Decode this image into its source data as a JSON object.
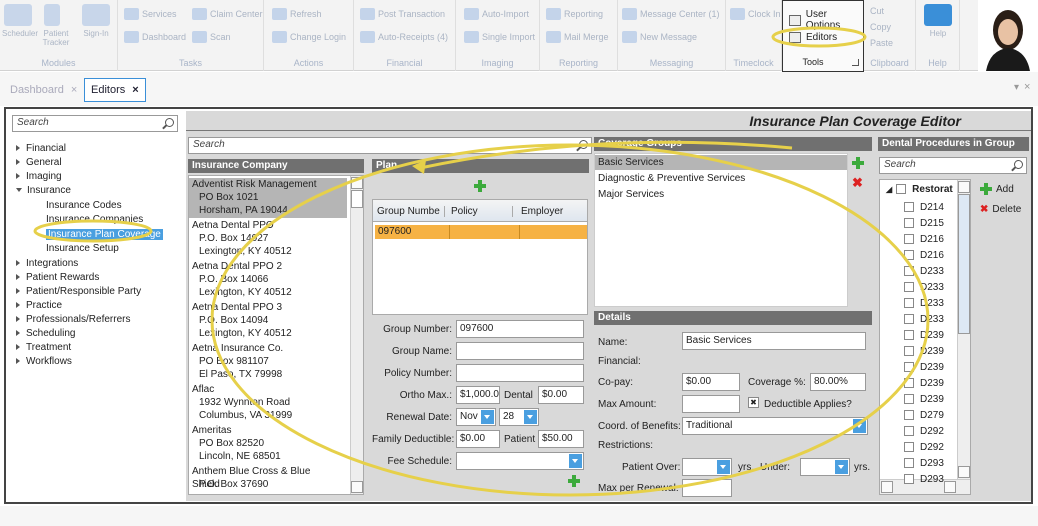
{
  "ribbon": {
    "modules": {
      "label": "Modules",
      "items": [
        "Scheduler",
        "Patient Tracker",
        "Sign-In"
      ]
    },
    "tasks": {
      "label": "Tasks",
      "items": [
        "Services",
        "Claim Center",
        "Dashboard",
        "Scan"
      ]
    },
    "actions": {
      "label": "Actions",
      "items": [
        "Refresh",
        "Change Login"
      ]
    },
    "financial": {
      "label": "Financial",
      "items": [
        "Post Transaction",
        "Auto-Receipts (4)"
      ]
    },
    "imaging": {
      "label": "Imaging",
      "items": [
        "Auto-Import",
        "Single Import"
      ]
    },
    "reporting": {
      "label": "Reporting",
      "items": [
        "Reporting",
        "Mail Merge"
      ]
    },
    "messaging": {
      "label": "Messaging",
      "items": [
        "Message Center (1)",
        "New Message"
      ]
    },
    "timeclock": {
      "label": "Timeclock",
      "items": [
        "Clock In"
      ]
    },
    "tools": {
      "label": "Tools",
      "items": [
        "User Options",
        "Editors"
      ]
    },
    "clipboard": {
      "label": "Clipboard",
      "items": [
        "Cut",
        "Copy",
        "Paste"
      ]
    },
    "help": {
      "label": "Help",
      "items": [
        "Help"
      ]
    }
  },
  "tabs": [
    {
      "label": "Dashboard"
    },
    {
      "label": "Editors"
    }
  ],
  "tabs_controls": {
    "pin": "▾",
    "close": "×"
  },
  "left": {
    "search_placeholder": "Search",
    "tree": [
      {
        "label": "Financial"
      },
      {
        "label": "General"
      },
      {
        "label": "Imaging"
      },
      {
        "label": "Insurance"
      },
      {
        "label": "Insurance Codes"
      },
      {
        "label": "Insurance Companies"
      },
      {
        "label": "Insurance Plan Coverage"
      },
      {
        "label": "Insurance Setup"
      },
      {
        "label": "Integrations"
      },
      {
        "label": "Patient Rewards"
      },
      {
        "label": "Patient/Responsible Party"
      },
      {
        "label": "Practice"
      },
      {
        "label": "Professionals/Referrers"
      },
      {
        "label": "Scheduling"
      },
      {
        "label": "Treatment"
      },
      {
        "label": "Workflows"
      }
    ]
  },
  "editor": {
    "title": "Insurance Plan Coverage Editor",
    "search_placeholder": "Search",
    "insurance_company": {
      "header": "Insurance Company",
      "items": [
        {
          "name": "Adventist Risk Management",
          "l1": "PO Box 1021",
          "l2": "Horsham, PA 19044"
        },
        {
          "name": "Aetna Dental PPO",
          "l1": "P.O. Box 14027",
          "l2": "Lexington, KY 40512"
        },
        {
          "name": "Aetna Dental PPO 2",
          "l1": "P.O. Box 14066",
          "l2": "Lexington, KY 40512"
        },
        {
          "name": "Aetna Dental PPO 3",
          "l1": "P.O. Box 14094",
          "l2": "Lexington, KY 40512"
        },
        {
          "name": "Aetna Insurance Co.",
          "l1": "PO Box 981107",
          "l2": "El Paso, TX 79998"
        },
        {
          "name": "Aflac",
          "l1": "1932 Wynnton Road",
          "l2": "Columbus, VA 31999"
        },
        {
          "name": "Ameritas",
          "l1": "PO Box 82520",
          "l2": "Lincoln, NE 68501"
        },
        {
          "name": "Anthem Blue Cross & Blue Shield",
          "l1": "P.O. Box 37690",
          "l2": ""
        }
      ]
    },
    "plan": {
      "header": "Plan",
      "columns": [
        "Group Numbe",
        "Policy",
        "Employer"
      ],
      "rows": [
        [
          "097600",
          "",
          ""
        ]
      ],
      "group_number_label": "Group Number:",
      "group_number": "097600",
      "group_name_label": "Group Name:",
      "group_name": "",
      "policy_number_label": "Policy Number:",
      "policy_number": "",
      "ortho_max_label": "Ortho Max.:",
      "ortho_max": "$1,000.0C",
      "dental_label": "Dental",
      "dental": "$0.00",
      "renewal_date_label": "Renewal Date:",
      "renewal_month": "Nov",
      "renewal_day": "28",
      "family_deductible_label": "Family Deductible:",
      "family_deductible": "$0.00",
      "patient_label": "Patient",
      "patient": "$50.00",
      "fee_schedule_label": "Fee Schedule:",
      "fee_schedule": ""
    },
    "coverage_groups": {
      "header": "Coverage Groups",
      "items": [
        "Basic Services",
        "Diagnostic & Preventive Services",
        "Major Services"
      ]
    },
    "details": {
      "header": "Details",
      "name_label": "Name:",
      "name": "Basic Services",
      "financial_label": "Financial:",
      "copay_label": "Co-pay:",
      "copay": "$0.00",
      "coverage_label": "Coverage %:",
      "coverage": "80.00%",
      "max_amount_label": "Max Amount:",
      "max_amount": "",
      "deductible_label": "Deductible Applies?",
      "deductible_mark": "✖",
      "cob_label": "Coord. of Benefits:",
      "cob": "Traditional",
      "restrictions_label": "Restrictions:",
      "patient_over_label": "Patient Over:",
      "yrs1": "yrs.",
      "under_label": "Under:",
      "yrs2": "yrs.",
      "max_renewal_label": "Max per Renewal:"
    },
    "procedures": {
      "header": "Dental Procedures in Group",
      "search_placeholder": "Search",
      "root": "Restorat",
      "codes": [
        "D214",
        "D215",
        "D216",
        "D216",
        "D233",
        "D233",
        "D233",
        "D233",
        "D239",
        "D239",
        "D239",
        "D239",
        "D239",
        "D279",
        "D292",
        "D292",
        "D293",
        "D293"
      ],
      "add_label": "Add",
      "delete_label": "Delete"
    }
  },
  "colors": {
    "selected": "#b5b5b5",
    "highlight": "#4a9fe0",
    "row_orange": "#f6b244",
    "annotation": "#e8d24a"
  }
}
